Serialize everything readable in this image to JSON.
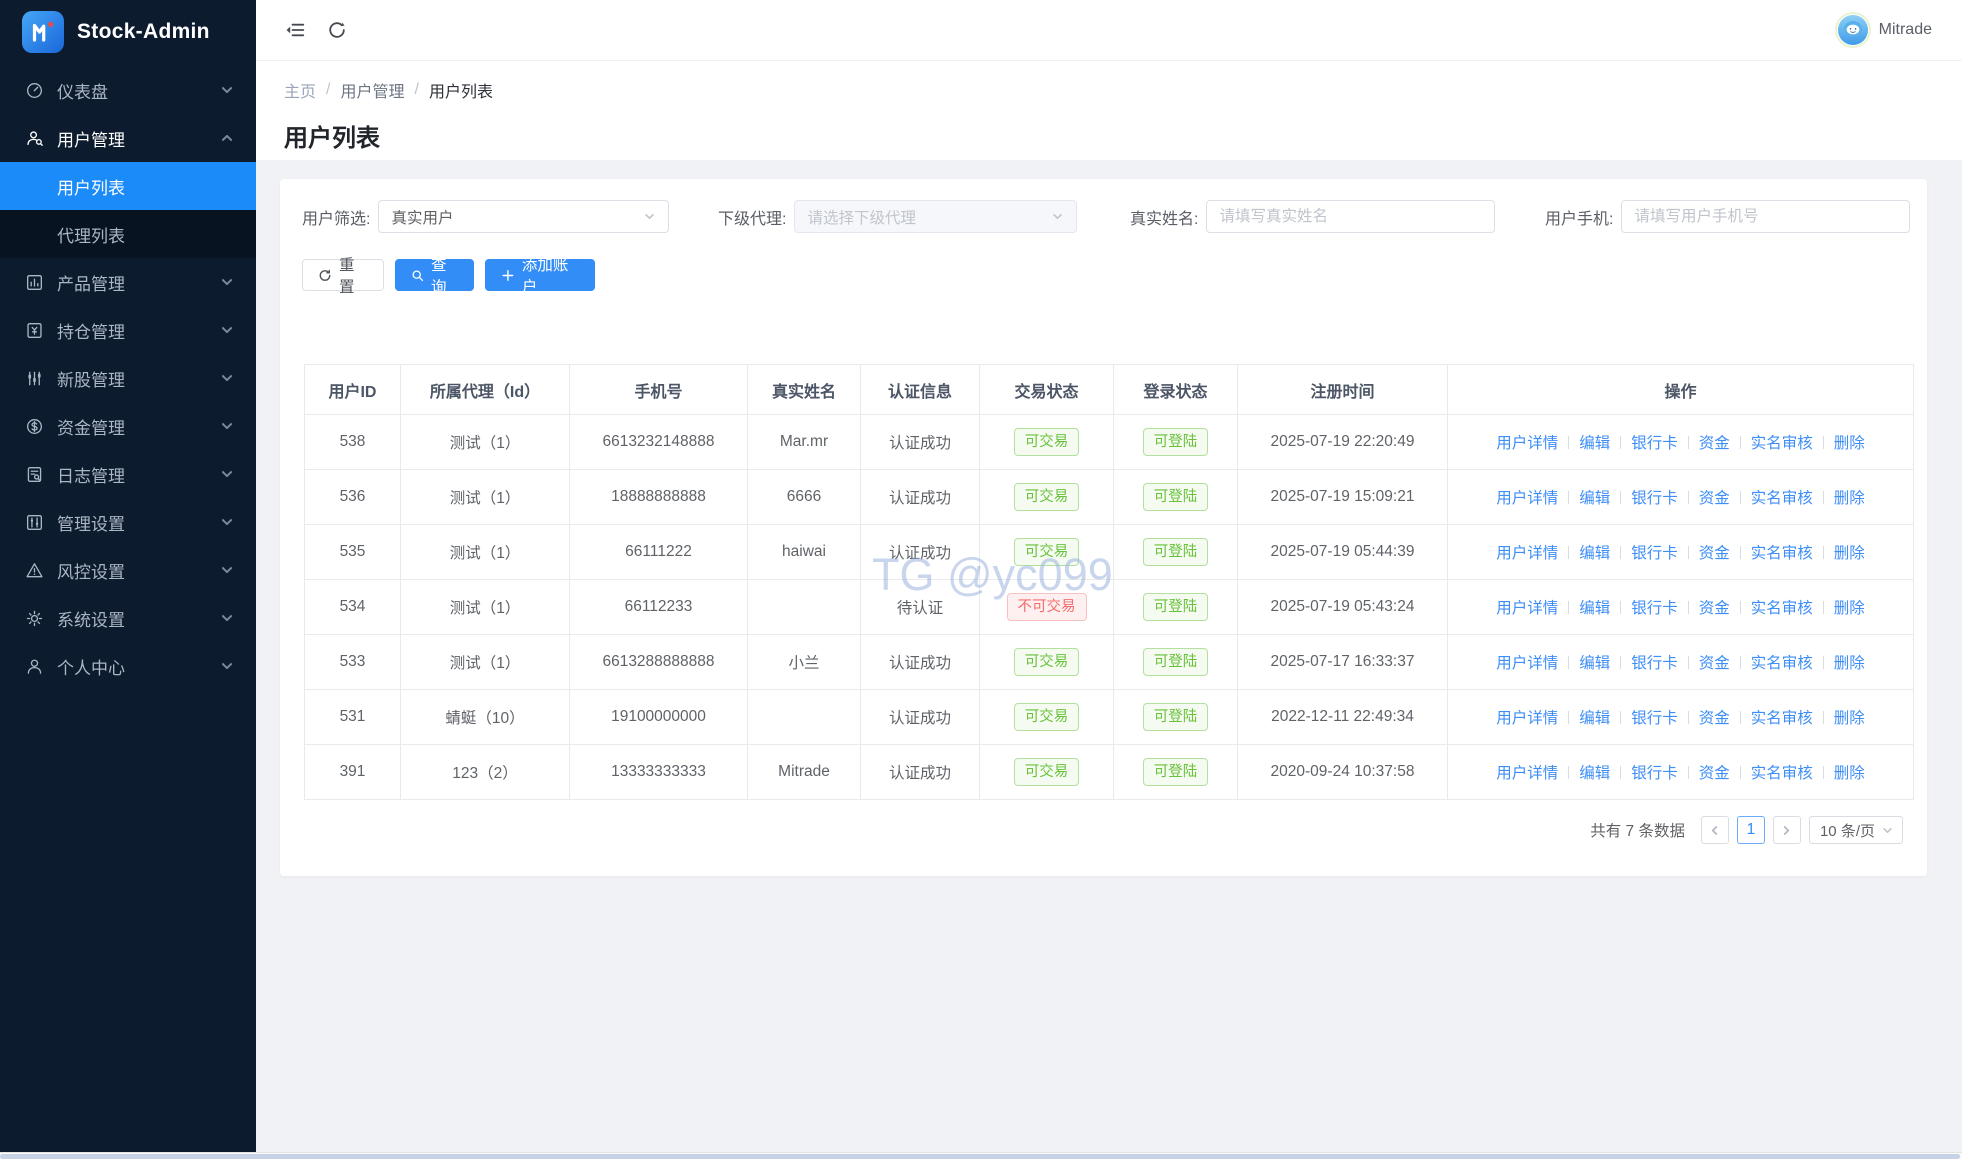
{
  "app": {
    "title": "Stock-Admin"
  },
  "topbar": {
    "user_name": "Mitrade"
  },
  "sidebar": {
    "items": [
      {
        "key": "dashboard",
        "label": "仪表盘",
        "icon": "dashboard-icon",
        "expanded": false
      },
      {
        "key": "user-management",
        "label": "用户管理",
        "icon": "user-manage-icon",
        "expanded": true,
        "children": [
          {
            "key": "user-list",
            "label": "用户列表",
            "active": true
          },
          {
            "key": "agent-list",
            "label": "代理列表",
            "active": false
          }
        ]
      },
      {
        "key": "product-management",
        "label": "产品管理",
        "icon": "product-icon",
        "expanded": false
      },
      {
        "key": "position-management",
        "label": "持仓管理",
        "icon": "position-icon",
        "expanded": false
      },
      {
        "key": "ipo-management",
        "label": "新股管理",
        "icon": "ipo-icon",
        "expanded": false
      },
      {
        "key": "funds-management",
        "label": "资金管理",
        "icon": "funds-icon",
        "expanded": false
      },
      {
        "key": "log-management",
        "label": "日志管理",
        "icon": "logs-icon",
        "expanded": false
      },
      {
        "key": "admin-settings",
        "label": "管理设置",
        "icon": "admin-settings-icon",
        "expanded": false
      },
      {
        "key": "risk-settings",
        "label": "风控设置",
        "icon": "risk-icon",
        "expanded": false
      },
      {
        "key": "system-settings",
        "label": "系统设置",
        "icon": "system-icon",
        "expanded": false
      },
      {
        "key": "profile-center",
        "label": "个人中心",
        "icon": "profile-icon",
        "expanded": false
      }
    ]
  },
  "breadcrumb": [
    "主页",
    "用户管理",
    "用户列表"
  ],
  "page": {
    "title": "用户列表"
  },
  "filters": {
    "user_filter_label": "用户筛选:",
    "user_filter_value": "真实用户",
    "agent_label": "下级代理:",
    "agent_placeholder": "请选择下级代理",
    "real_name_label": "真实姓名:",
    "real_name_placeholder": "请填写真实姓名",
    "phone_label": "用户手机:",
    "phone_placeholder": "请填写用户手机号"
  },
  "actions": {
    "reset": "重置",
    "search": "查询",
    "add_account": "添加账户"
  },
  "table": {
    "columns": [
      "用户ID",
      "所属代理（Id）",
      "手机号",
      "真实姓名",
      "认证信息",
      "交易状态",
      "登录状态",
      "注册时间",
      "操作"
    ],
    "row_actions": [
      "用户详情",
      "编辑",
      "银行卡",
      "资金",
      "实名审核",
      "删除"
    ],
    "row_action_keys": [
      "user-detail",
      "edit",
      "bank-card",
      "funds",
      "real-name-audit",
      "delete"
    ],
    "rows": [
      {
        "id": "538",
        "agent": "测试（1）",
        "phone": "6613232148888",
        "real_name": "Mar.mr",
        "auth": "认证成功",
        "trade_status": "可交易",
        "trade_ok": true,
        "login_status": "可登陆",
        "reg_time": "2025-07-19 22:20:49"
      },
      {
        "id": "536",
        "agent": "测试（1）",
        "phone": "18888888888",
        "real_name": "6666",
        "auth": "认证成功",
        "trade_status": "可交易",
        "trade_ok": true,
        "login_status": "可登陆",
        "reg_time": "2025-07-19 15:09:21"
      },
      {
        "id": "535",
        "agent": "测试（1）",
        "phone": "66111222",
        "real_name": "haiwai",
        "auth": "认证成功",
        "trade_status": "可交易",
        "trade_ok": true,
        "login_status": "可登陆",
        "reg_time": "2025-07-19 05:44:39"
      },
      {
        "id": "534",
        "agent": "测试（1）",
        "phone": "66112233",
        "real_name": "",
        "auth": "待认证",
        "trade_status": "不可交易",
        "trade_ok": false,
        "login_status": "可登陆",
        "reg_time": "2025-07-19 05:43:24"
      },
      {
        "id": "533",
        "agent": "测试（1）",
        "phone": "6613288888888",
        "real_name": "小兰",
        "auth": "认证成功",
        "trade_status": "可交易",
        "trade_ok": true,
        "login_status": "可登陆",
        "reg_time": "2025-07-17 16:33:37"
      },
      {
        "id": "531",
        "agent": "蜻蜓（10）",
        "phone": "19100000000",
        "real_name": "",
        "auth": "认证成功",
        "trade_status": "可交易",
        "trade_ok": true,
        "login_status": "可登陆",
        "reg_time": "2022-12-11 22:49:34"
      },
      {
        "id": "391",
        "agent": "123（2）",
        "phone": "13333333333",
        "real_name": "Mitrade",
        "auth": "认证成功",
        "trade_status": "可交易",
        "trade_ok": true,
        "login_status": "可登陆",
        "reg_time": "2020-09-24 10:37:58"
      }
    ]
  },
  "pagination": {
    "total_text": "共有 7 条数据",
    "current_page": "1",
    "page_size": "10 条/页"
  },
  "watermark": "TG @yc099",
  "colors": {
    "sidebar_bg": "#0d1b2e",
    "submenu_bg": "#081322",
    "active_blue": "#1c8bfa",
    "primary": "#338df7",
    "link": "#3e8ef7",
    "success": "#67c23a",
    "danger": "#f56c6c",
    "content_bg": "#f0f2f5",
    "table_border": "#e8eaec"
  }
}
